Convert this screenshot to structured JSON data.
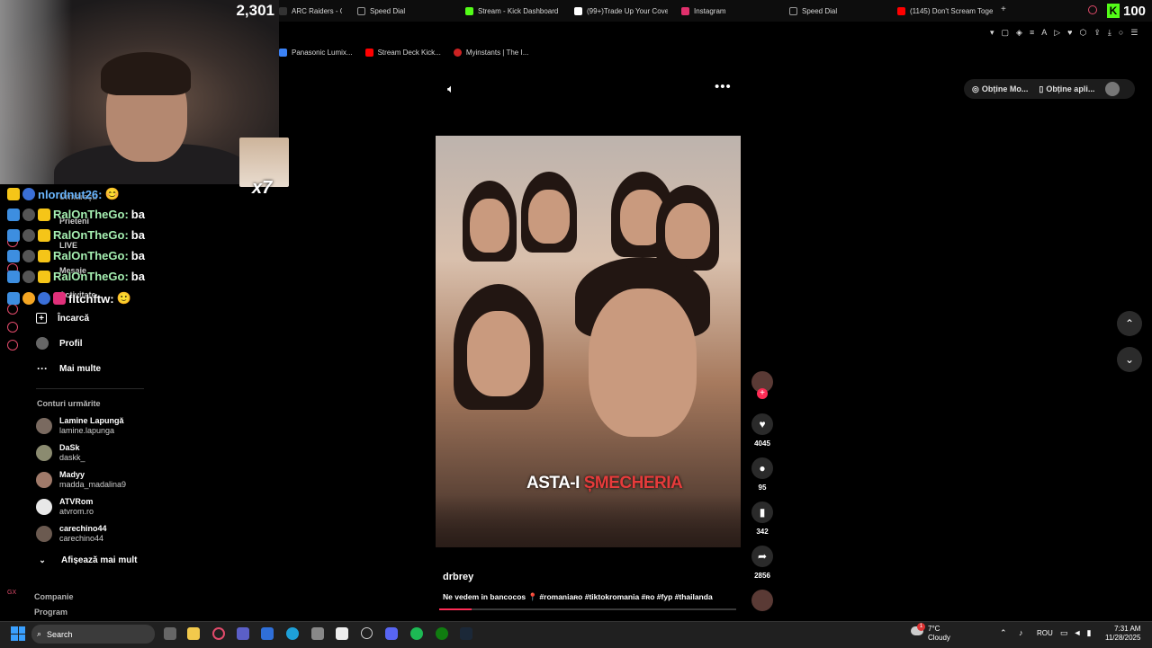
{
  "browser": {
    "tabs": [
      {
        "label": "ARC Raiders - Offi",
        "icon": "arc-icon",
        "color": "#333333"
      },
      {
        "label": "Speed Dial",
        "icon": "speed-dial-icon",
        "color": "#555555"
      },
      {
        "label": "Stream - Kick Dashboard",
        "icon": "kick-icon",
        "color": "#53fc18"
      },
      {
        "label": "(99+)Trade Up Your Cove",
        "icon": "tiktok-icon",
        "color": "#ffffff"
      },
      {
        "label": "Instagram",
        "icon": "instagram-icon",
        "color": "#e1306c"
      },
      {
        "label": "Speed Dial",
        "icon": "speed-dial-icon",
        "color": "#555555"
      },
      {
        "label": "(1145) Don't Scream Toge",
        "icon": "youtube-icon",
        "color": "#ff0000"
      }
    ],
    "new_tab": "+",
    "bookmarks": [
      {
        "label": "Panasonic Lumix...",
        "color": "#3b82f6"
      },
      {
        "label": "Stream Deck Kick...",
        "color": "#ff0000"
      },
      {
        "label": "Myinstants | The I...",
        "color": "#cc2222"
      }
    ]
  },
  "stream_overlay": {
    "viewer_count": "2,301",
    "kick_count": "100",
    "kick_letter": "K",
    "multiplier": "x7",
    "chat": [
      {
        "user": "nlordnut26:",
        "msg": "😊",
        "user_color": "#6bb7ff"
      },
      {
        "user": "RalOnTheGo:",
        "msg": "ba",
        "user_color": "#a6f0b2"
      },
      {
        "user": "RalOnTheGo:",
        "msg": "ba",
        "user_color": "#a6f0b2"
      },
      {
        "user": "RalOnTheGo:",
        "msg": "ba",
        "user_color": "#a6f0b2"
      },
      {
        "user": "RalOnTheGo:",
        "msg": "ba",
        "user_color": "#a6f0b2"
      },
      {
        "user": "fltchftw:",
        "msg": "🙂",
        "user_color": "#ffffff"
      }
    ]
  },
  "sidebar": {
    "hidden_items": [
      "Urmărești",
      "Prieteni",
      "LIVE",
      "Mesaje",
      "Activitate"
    ],
    "items": [
      {
        "label": "Încarcă",
        "icon": "plus-square-icon"
      },
      {
        "label": "Profil",
        "icon": "profile-icon"
      },
      {
        "label": "Mai multe",
        "icon": "more-icon"
      }
    ],
    "following_title": "Conturi urmărite",
    "accounts": [
      {
        "name": "Lamine Lapungă",
        "handle": "lamine.lapunga"
      },
      {
        "name": "DaSk",
        "handle": "daskk_"
      },
      {
        "name": "Madyy",
        "handle": "madda_madalina9"
      },
      {
        "name": "ATVRom",
        "handle": "atvrom.ro"
      },
      {
        "name": "carechino44",
        "handle": "carechino44"
      }
    ],
    "show_more": "Afișează mai mult",
    "footer": [
      "Companie",
      "Program"
    ]
  },
  "header_actions": {
    "get_mode": "Obține Mo...",
    "get_app": "Obține apli..."
  },
  "video": {
    "caption_part1": "ASTA-I ",
    "caption_part2": "ȘMECHERIA",
    "author": "drbrey",
    "description": "Ne vedem in bancocos 📍 #romaniaʀᴏ #tiktokromania #ʀᴏ #fyp #thailanda",
    "progress": 0.11,
    "likes": "4045",
    "comments": "95",
    "saves": "342",
    "shares": "2856"
  },
  "taskbar": {
    "search": "Search",
    "weather_temp": "7°C",
    "weather_desc": "Cloudy",
    "language": "ROU",
    "time": "7:31 AM",
    "date": "11/28/2025",
    "notification_count": "1"
  }
}
